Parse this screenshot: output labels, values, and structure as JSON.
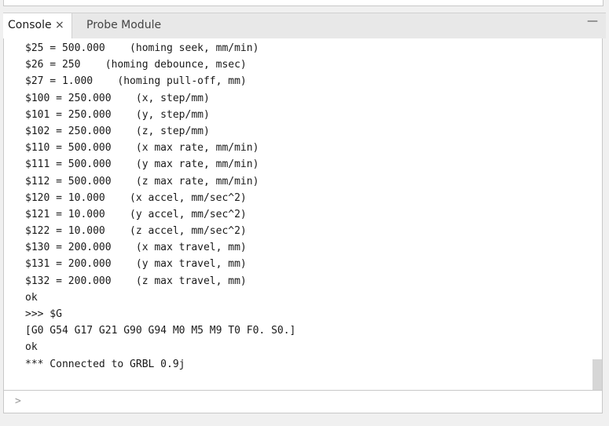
{
  "tabs": {
    "console": {
      "label": "Console",
      "close": "×"
    },
    "probe": {
      "label": "Probe Module"
    },
    "minimize": "—"
  },
  "console": {
    "lines": [
      "$25 = 500.000    (homing seek, mm/min)",
      "$26 = 250    (homing debounce, msec)",
      "$27 = 1.000    (homing pull-off, mm)",
      "$100 = 250.000    (x, step/mm)",
      "$101 = 250.000    (y, step/mm)",
      "$102 = 250.000    (z, step/mm)",
      "$110 = 500.000    (x max rate, mm/min)",
      "$111 = 500.000    (y max rate, mm/min)",
      "$112 = 500.000    (z max rate, mm/min)",
      "$120 = 10.000    (x accel, mm/sec^2)",
      "$121 = 10.000    (y accel, mm/sec^2)",
      "$122 = 10.000    (z accel, mm/sec^2)",
      "$130 = 200.000    (x max travel, mm)",
      "$131 = 200.000    (y max travel, mm)",
      "$132 = 200.000    (z max travel, mm)",
      "ok",
      ">>> $G",
      "[G0 G54 G17 G21 G90 G94 M0 M5 M9 T0 F0. S0.]",
      "ok",
      "*** Connected to GRBL 0.9j"
    ]
  },
  "input": {
    "prompt": ">",
    "value": ""
  }
}
